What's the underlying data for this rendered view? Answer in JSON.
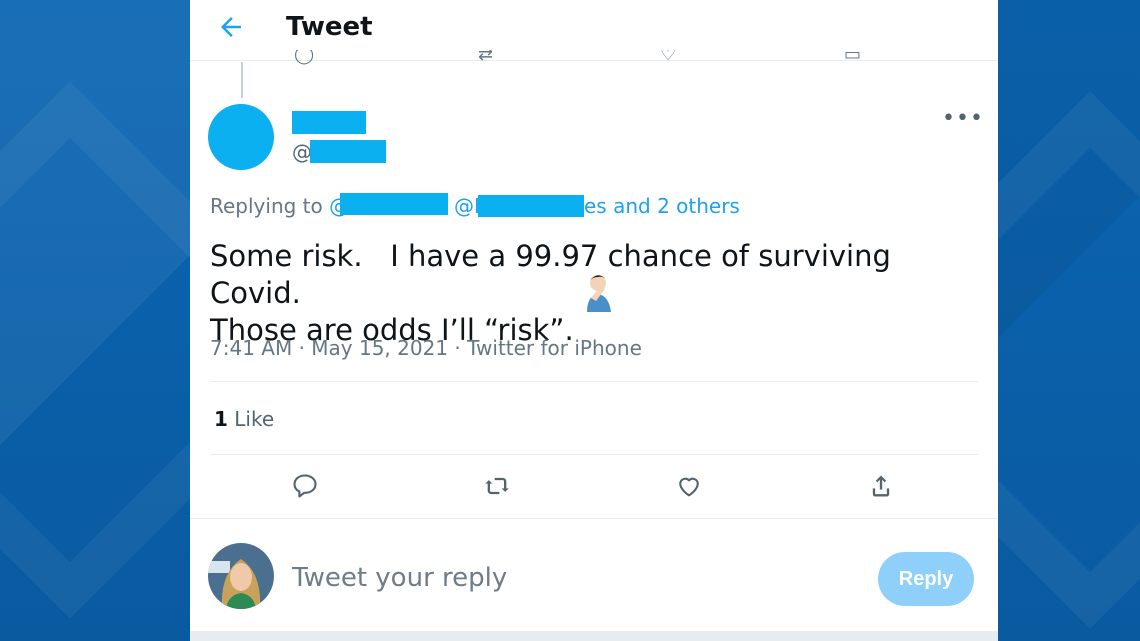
{
  "header": {
    "back_icon": "arrow-left-icon",
    "title": "Tweet"
  },
  "tweet": {
    "handle_prefix": "@",
    "replying_prefix": "Replying to ",
    "mention_one_visible": "@T",
    "mention_two_visible": "@I",
    "mention_tail": "es and 2 others",
    "more_icon": "more-dots-icon",
    "text": "Some risk.   I have a 99.97 chance of surviving Covid.\nThose are odds I’ll “risk”.",
    "emoji": "facepalm-emoji",
    "meta": "7:41 AM · May 15, 2021 · Twitter for iPhone",
    "like_count": "1",
    "like_label": " Like",
    "actions": [
      "comment-icon",
      "retweet-icon",
      "heart-icon",
      "share-icon"
    ]
  },
  "compose": {
    "placeholder": "Tweet your reply",
    "reply_label": "Reply"
  },
  "colors": {
    "accent": "#1da1f2",
    "redaction": "#0ab0f0",
    "reply_button_disabled": "#8ed0f9",
    "background_blue": "#0a5fa8"
  }
}
